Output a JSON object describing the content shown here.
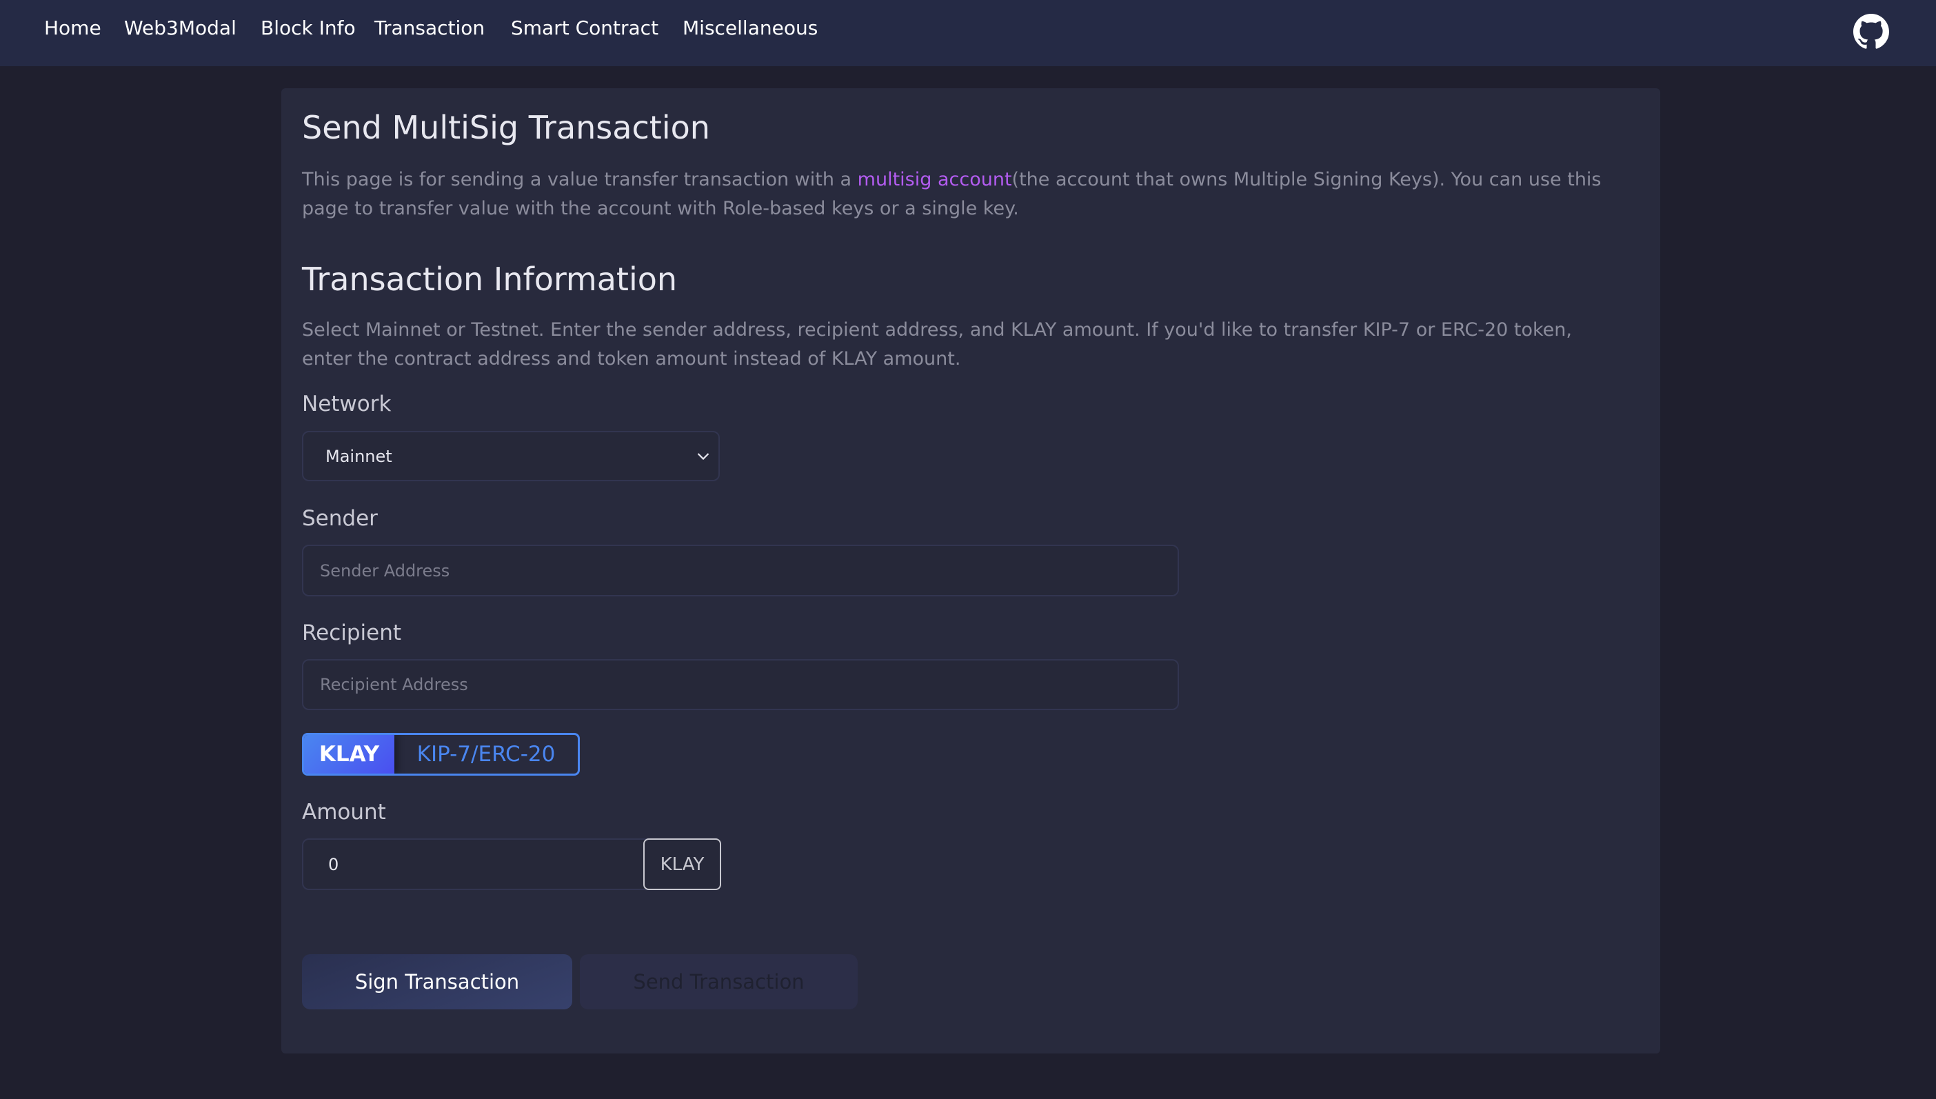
{
  "nav": {
    "items": [
      "Home",
      "Web3Modal",
      "Block Info",
      "Transaction",
      "Smart Contract",
      "Miscellaneous"
    ],
    "github_icon": "github-icon"
  },
  "page": {
    "title": "Send MultiSig Transaction",
    "intro_before": "This page is for sending a value transfer transaction with a ",
    "intro_link": "multisig account",
    "intro_after": "(the account that owns Multiple Signing Keys). You can use this page to transfer value with the account with Role-based keys or a single key.",
    "section_title": "Transaction Information",
    "section_desc": "Select Mainnet or Testnet. Enter the sender address, recipient address, and KLAY amount. If you'd like to transfer KIP-7 or ERC-20 token, enter the contract address and token amount instead of KLAY amount."
  },
  "form": {
    "network_label": "Network",
    "network_value": "Mainnet",
    "sender_label": "Sender",
    "sender_placeholder": "Sender Address",
    "recipient_label": "Recipient",
    "recipient_placeholder": "Recipient Address",
    "token_toggle": {
      "options": [
        "KLAY",
        "KIP-7/ERC-20"
      ],
      "selected": "KLAY"
    },
    "amount_label": "Amount",
    "amount_value": "0",
    "amount_unit": "KLAY",
    "sign_button": "Sign Transaction",
    "send_button": "Send Transaction"
  },
  "colors": {
    "accent": "#4a86f0",
    "link": "#b35cf0",
    "background": "#1f1f2e",
    "card": "#282a3d",
    "navbar": "#252a45"
  }
}
